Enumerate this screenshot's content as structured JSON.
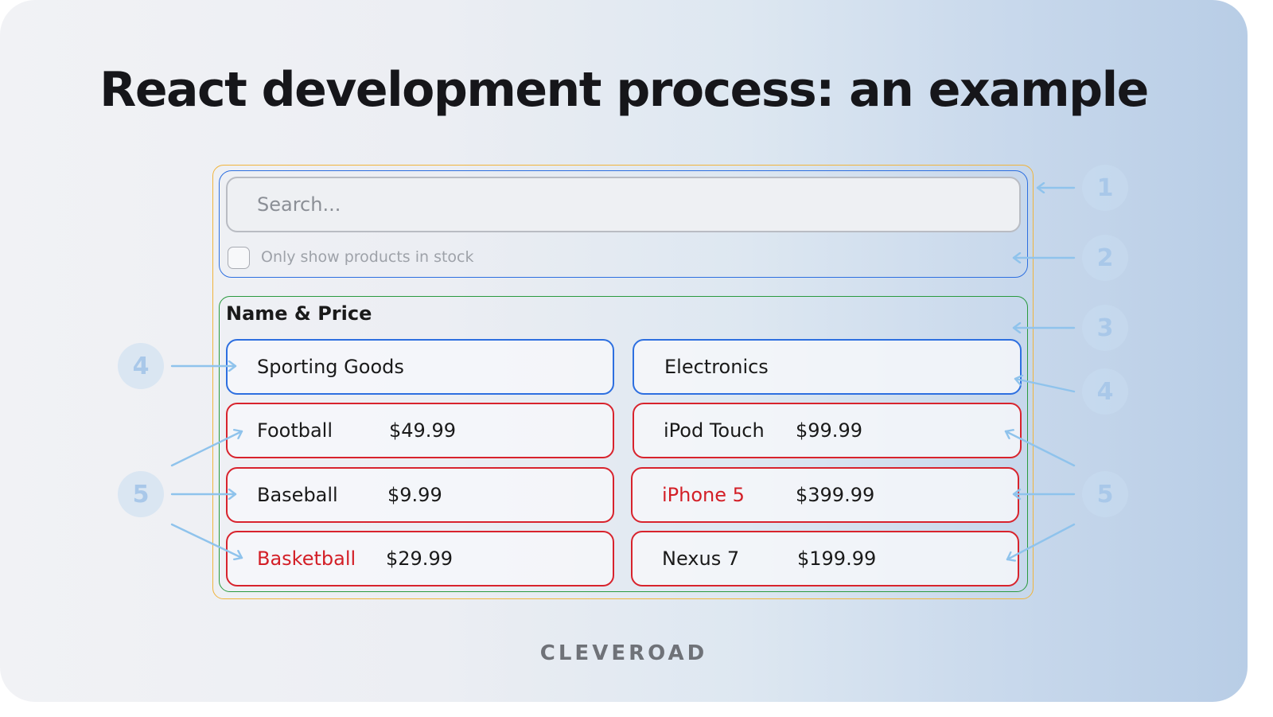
{
  "title": "React development process: an example",
  "search": {
    "placeholder": "Search..."
  },
  "filter": {
    "label": "Only show products in stock",
    "checked": false
  },
  "table": {
    "header": "Name & Price",
    "columns": [
      {
        "category": "Sporting Goods",
        "products": [
          {
            "name": "Football",
            "price": "$49.99",
            "in_stock": true
          },
          {
            "name": "Baseball",
            "price": "$9.99",
            "in_stock": true
          },
          {
            "name": "Basketball",
            "price": "$29.99",
            "in_stock": false
          }
        ]
      },
      {
        "category": "Electronics",
        "products": [
          {
            "name": "iPod Touch",
            "price": "$99.99",
            "in_stock": true
          },
          {
            "name": "iPhone 5",
            "price": "$399.99",
            "in_stock": false
          },
          {
            "name": "Nexus 7",
            "price": "$199.99",
            "in_stock": true
          }
        ]
      }
    ]
  },
  "callouts": [
    "1",
    "2",
    "3",
    "4",
    "5"
  ],
  "brand": "CLEVEROAD",
  "colors": {
    "outer_frame": "#f0b43c",
    "search_frame": "#2d6fe0",
    "table_frame": "#2a9a3f",
    "category_border": "#2d6fe0",
    "product_border": "#d8232d",
    "out_of_stock_text": "#d31f27",
    "callout": "#a9c8e9"
  }
}
